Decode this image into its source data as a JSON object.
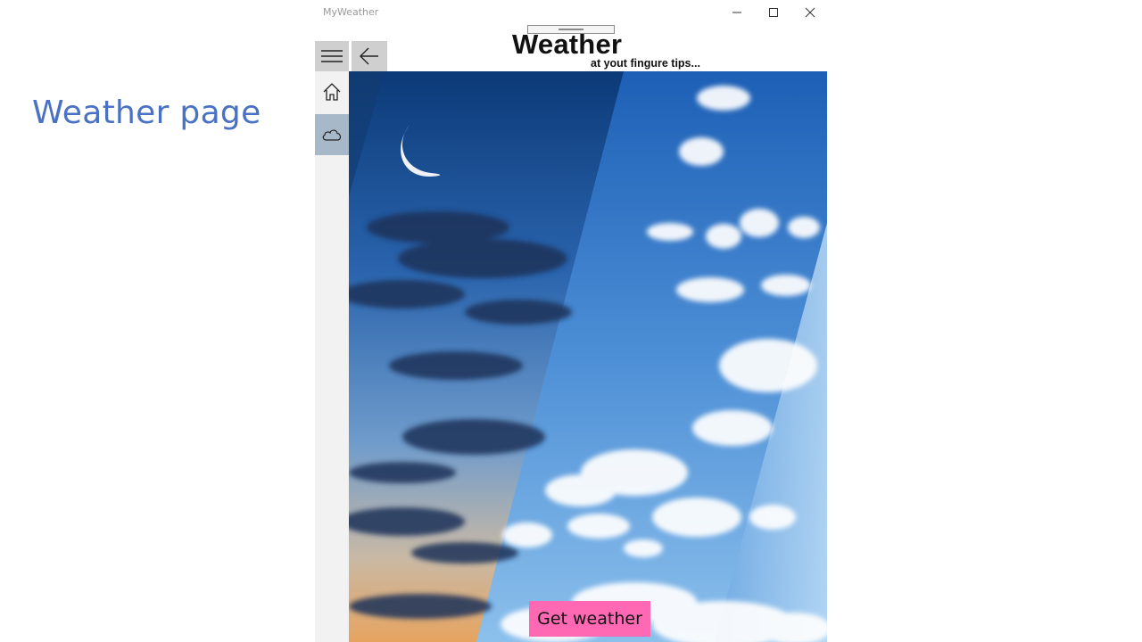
{
  "slide": {
    "title": "Weather page"
  },
  "window": {
    "title": "MyWeather",
    "controls": [
      "minimize",
      "maximize",
      "close"
    ]
  },
  "header": {
    "title": "Weather",
    "tagline": "at yout fingure tips..."
  },
  "navigation": {
    "items": [
      {
        "name": "home",
        "icon": "home-icon",
        "selected": false
      },
      {
        "name": "weather",
        "icon": "cloud-icon",
        "selected": true
      }
    ]
  },
  "actions": {
    "get_weather_label": "Get weather"
  },
  "colors": {
    "slide_title": "#4a72c4",
    "button_background": "#ff69b4",
    "nav_selected": "#a7b8c9",
    "nav_pane": "#f2f2f2",
    "toolbar_button": "#cfcfcf"
  }
}
